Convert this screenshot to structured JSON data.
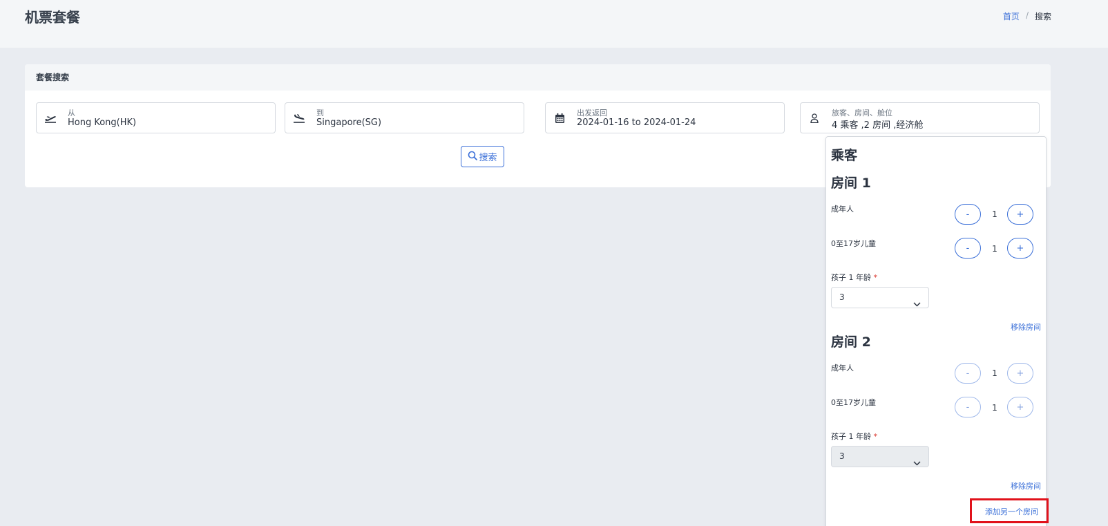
{
  "header": {
    "title": "机票套餐",
    "breadcrumb": {
      "home": "首页",
      "separator": "/",
      "current": "搜索"
    }
  },
  "search_card": {
    "title": "套餐搜索",
    "from": {
      "icon": "plane-takeoff-icon",
      "label": "从",
      "value": "Hong Kong(HK)"
    },
    "to": {
      "icon": "plane-landing-icon",
      "label": "到",
      "value": "Singapore(SG)"
    },
    "dates": {
      "icon": "calendar-icon",
      "label": "出发返回",
      "value": "2024-01-16 to 2024-01-24"
    },
    "travelers": {
      "icon": "person-icon",
      "label": "旅客、房间、舱位",
      "value": "4 乘客 ,2 房间 ,经济舱"
    },
    "search_button": {
      "icon": "search-icon",
      "label": "搜索"
    }
  },
  "travelers_dropdown": {
    "title": "乘客",
    "rooms": [
      {
        "title": "房间 1",
        "adults": {
          "label": "成年人",
          "value": "1",
          "minus": "-",
          "plus": "+"
        },
        "children": {
          "label": "0至17岁儿童",
          "value": "1",
          "minus": "-",
          "plus": "+"
        },
        "child_age": {
          "label": "孩子 1 年龄",
          "required": "*",
          "value": "3"
        },
        "remove_label": "移除房间"
      },
      {
        "title": "房间 2",
        "adults": {
          "label": "成年人",
          "value": "1",
          "minus": "-",
          "plus": "+"
        },
        "children": {
          "label": "0至17岁儿童",
          "value": "1",
          "minus": "-",
          "plus": "+"
        },
        "child_age": {
          "label": "孩子 1 年龄",
          "required": "*",
          "value": "3"
        },
        "remove_label": "移除房间"
      }
    ],
    "add_room_label": "添加另一个房间"
  },
  "colors": {
    "accent": "#3a6fd8",
    "highlight": "#e1121b",
    "page_bg": "#e9ecf1",
    "header_bg": "#f4f6f8"
  }
}
